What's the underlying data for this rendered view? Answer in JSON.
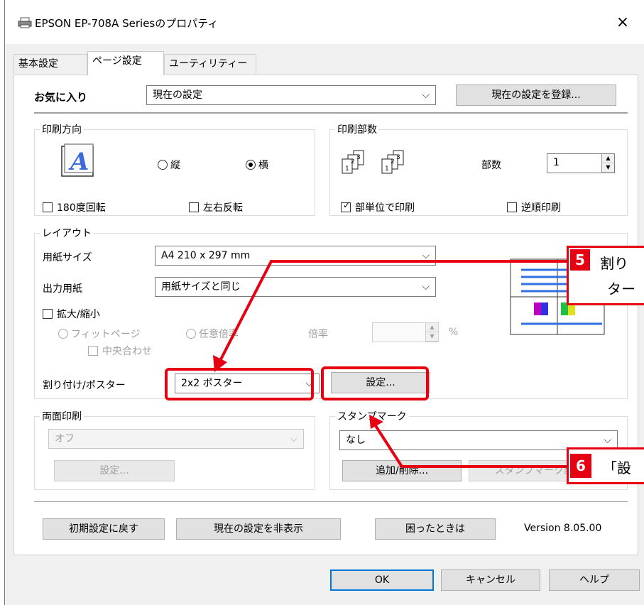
{
  "window": {
    "title": "EPSON EP-708A Seriesのプロパティ",
    "close": "×"
  },
  "tabs": [
    "基本設定",
    "ページ設定",
    "ユーティリティー"
  ],
  "favorites": {
    "label": "お気に入り",
    "value": "現在の設定",
    "register": "現在の設定を登録..."
  },
  "orientation": {
    "label": "印刷方向",
    "portrait": "縦",
    "landscape": "横",
    "rotate180": "180度回転",
    "mirror": "左右反転"
  },
  "copies": {
    "label": "印刷部数",
    "count_label": "部数",
    "count_value": "1",
    "collate": "部単位で印刷",
    "reverse": "逆順印刷"
  },
  "layout": {
    "label": "レイアウト",
    "paper_size_label": "用紙サイズ",
    "paper_size_value": "A4 210 x 297 mm",
    "output_paper_label": "出力用紙",
    "output_paper_value": "用紙サイズと同じ",
    "scale_label": "拡大/縮小",
    "fit_page": "フィットページ",
    "any_ratio": "任意倍率",
    "ratio_label": "倍率",
    "percent": "%",
    "center": "中央合わせ",
    "nup_label": "割り付け/ポスター",
    "nup_value": "2x2 ポスター",
    "settings_btn": "設定..."
  },
  "duplex": {
    "label": "両面印刷",
    "value": "オフ",
    "settings_btn": "設定..."
  },
  "stamp": {
    "label": "スタンプマーク",
    "value": "なし",
    "add_remove": "追加/削除...",
    "stamp_settings": "スタンプマーク設定..."
  },
  "bottom_buttons": {
    "reset": "初期設定に戻す",
    "hide": "現在の設定を非表示",
    "help_trouble": "困ったときは",
    "version": "Version 8.05.00"
  },
  "dialog_buttons": {
    "ok": "OK",
    "cancel": "キャンセル",
    "help": "ヘルプ"
  },
  "callouts": [
    {
      "num": "5",
      "line1": "割り",
      "line2": "ター"
    },
    {
      "num": "6",
      "text": "「設"
    }
  ],
  "colors": {
    "highlight": "#e60012",
    "focus": "#0078d7"
  }
}
